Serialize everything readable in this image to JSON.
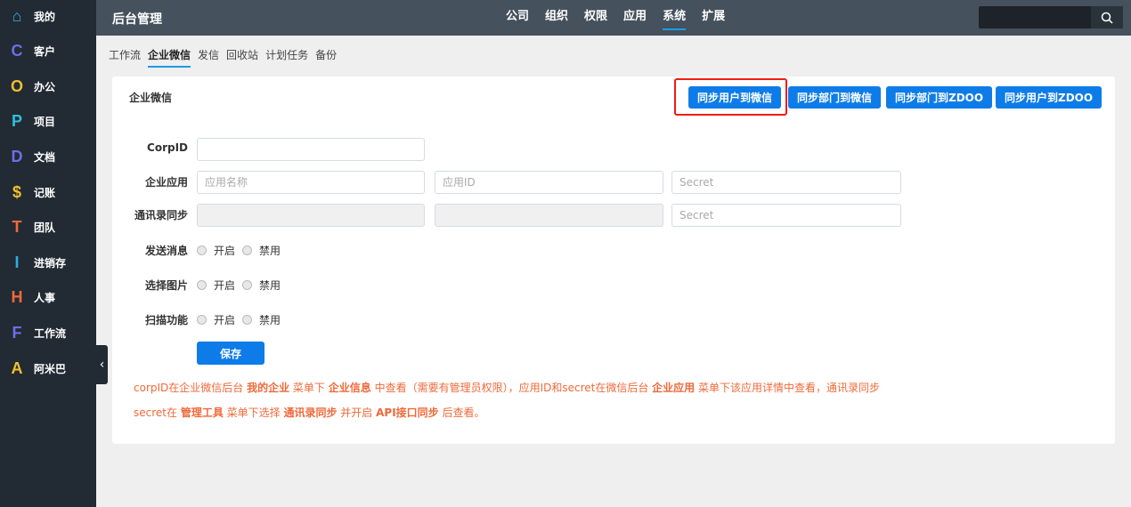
{
  "sidebar": {
    "items": [
      {
        "icon": "⌂",
        "label": "我的",
        "color": "#2fb3e8"
      },
      {
        "icon": "C",
        "label": "客户",
        "color": "#6b6fe8"
      },
      {
        "icon": "O",
        "label": "办公",
        "color": "#f0c030"
      },
      {
        "icon": "P",
        "label": "项目",
        "color": "#2cc0e0"
      },
      {
        "icon": "D",
        "label": "文档",
        "color": "#6b6fe8"
      },
      {
        "icon": "$",
        "label": "记账",
        "color": "#f0c030"
      },
      {
        "icon": "T",
        "label": "团队",
        "color": "#f06a3a"
      },
      {
        "icon": "I",
        "label": "进销存",
        "color": "#2cb0e0"
      },
      {
        "icon": "H",
        "label": "人事",
        "color": "#f06a3a"
      },
      {
        "icon": "F",
        "label": "工作流",
        "color": "#6b6fe8"
      },
      {
        "icon": "A",
        "label": "阿米巴",
        "color": "#f0c030"
      }
    ],
    "collapse": "‹"
  },
  "header": {
    "title": "后台管理",
    "nav": [
      "公司",
      "组织",
      "权限",
      "应用",
      "系统",
      "扩展"
    ],
    "active": "系统",
    "search_icon": "⚲"
  },
  "subnav": {
    "items": [
      "工作流",
      "企业微信",
      "发信",
      "回收站",
      "计划任务",
      "备份"
    ],
    "active": "企业微信"
  },
  "panel": {
    "title": "企业微信",
    "actions": [
      "同步用户到微信",
      "同步部门到微信",
      "同步部门到ZDOO",
      "同步用户到ZDOO"
    ]
  },
  "form": {
    "corpid_label": "CorpID",
    "corpid_value": "",
    "app_label": "企业应用",
    "app_name_ph": "应用名称",
    "app_id_ph": "应用ID",
    "app_secret_ph": "Secret",
    "contacts_label": "通讯录同步",
    "contacts_secret_ph": "Secret",
    "radios": [
      {
        "label": "发送消息",
        "on": "开启",
        "off": "禁用"
      },
      {
        "label": "选择图片",
        "on": "开启",
        "off": "禁用"
      },
      {
        "label": "扫描功能",
        "on": "开启",
        "off": "禁用"
      }
    ],
    "save": "保存"
  },
  "note": {
    "line1": [
      "corpID在企业微信后台 ",
      "我的企业",
      " 菜单下 ",
      "企业信息",
      " 中查看（需要有管理员权限），应用ID和secret在微信后台 ",
      "企业应用",
      " 菜单下该应用详情中查看，通讯录同步"
    ],
    "line2": [
      "secret在 ",
      "管理工具",
      " 菜单下选择 ",
      "通讯录同步",
      " 并开启 ",
      "API接口同步",
      " 后查看。"
    ]
  }
}
